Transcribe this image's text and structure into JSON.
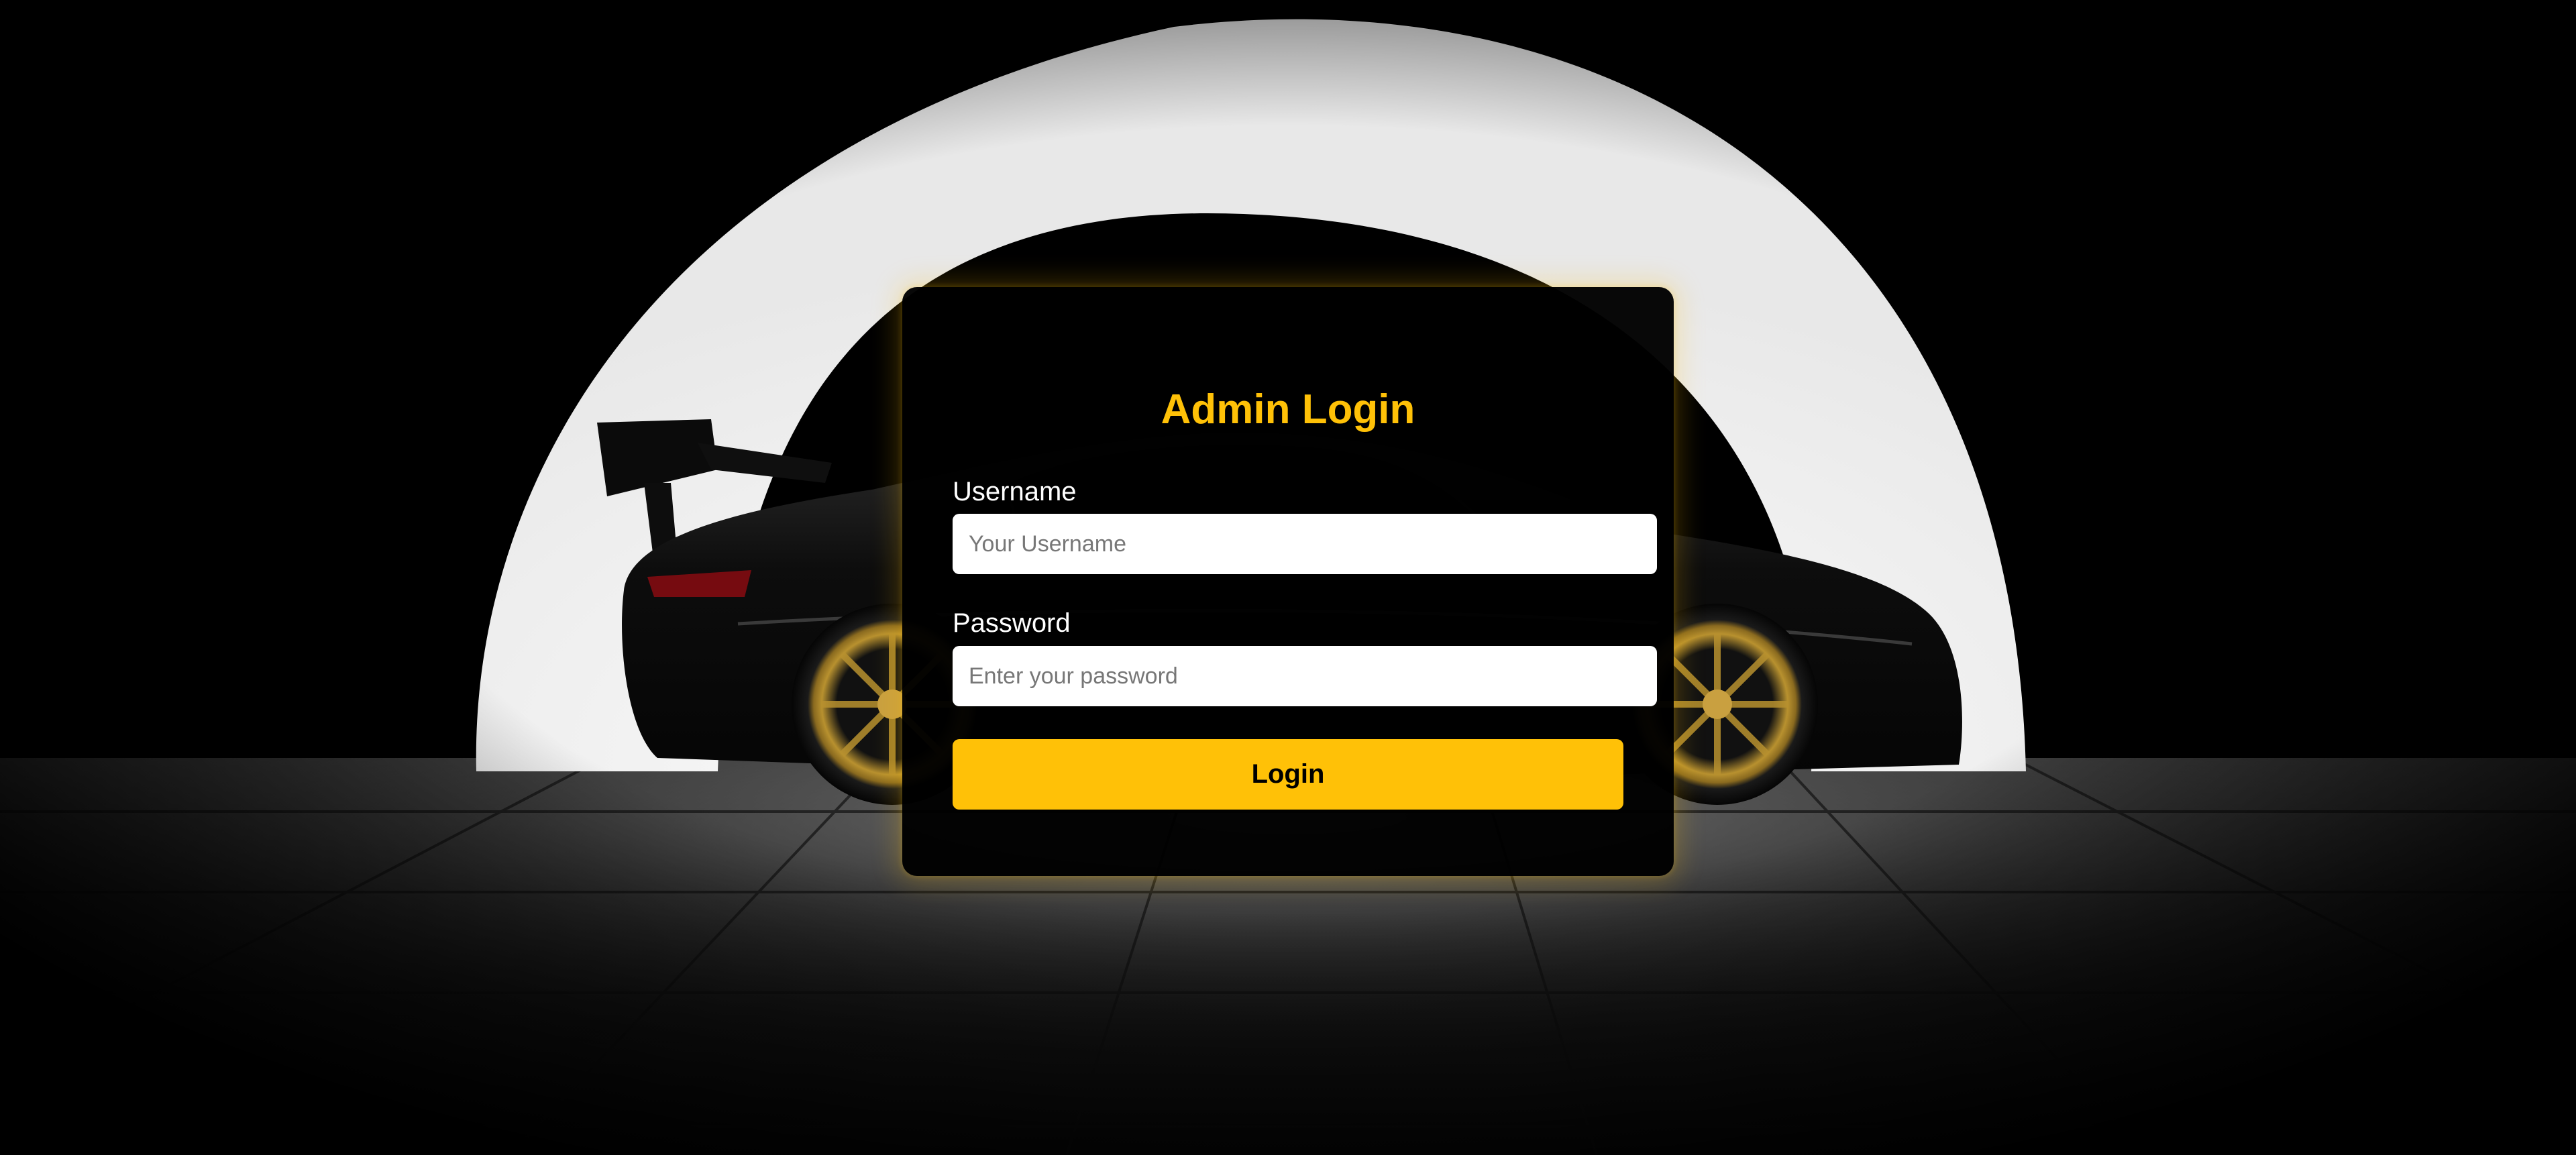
{
  "colors": {
    "accent": "#ffc107",
    "panel_background": "#000000",
    "input_background": "#ffffff",
    "label_text": "#ffffff",
    "placeholder_text": "#777777"
  },
  "background": {
    "image": "black-sports-car-in-studio"
  },
  "login_form": {
    "title": "Admin Login",
    "username_label": "Username",
    "username_placeholder": "Your Username",
    "username_value": "",
    "password_label": "Password",
    "password_placeholder": "Enter your password",
    "password_value": "",
    "submit_label": "Login"
  }
}
